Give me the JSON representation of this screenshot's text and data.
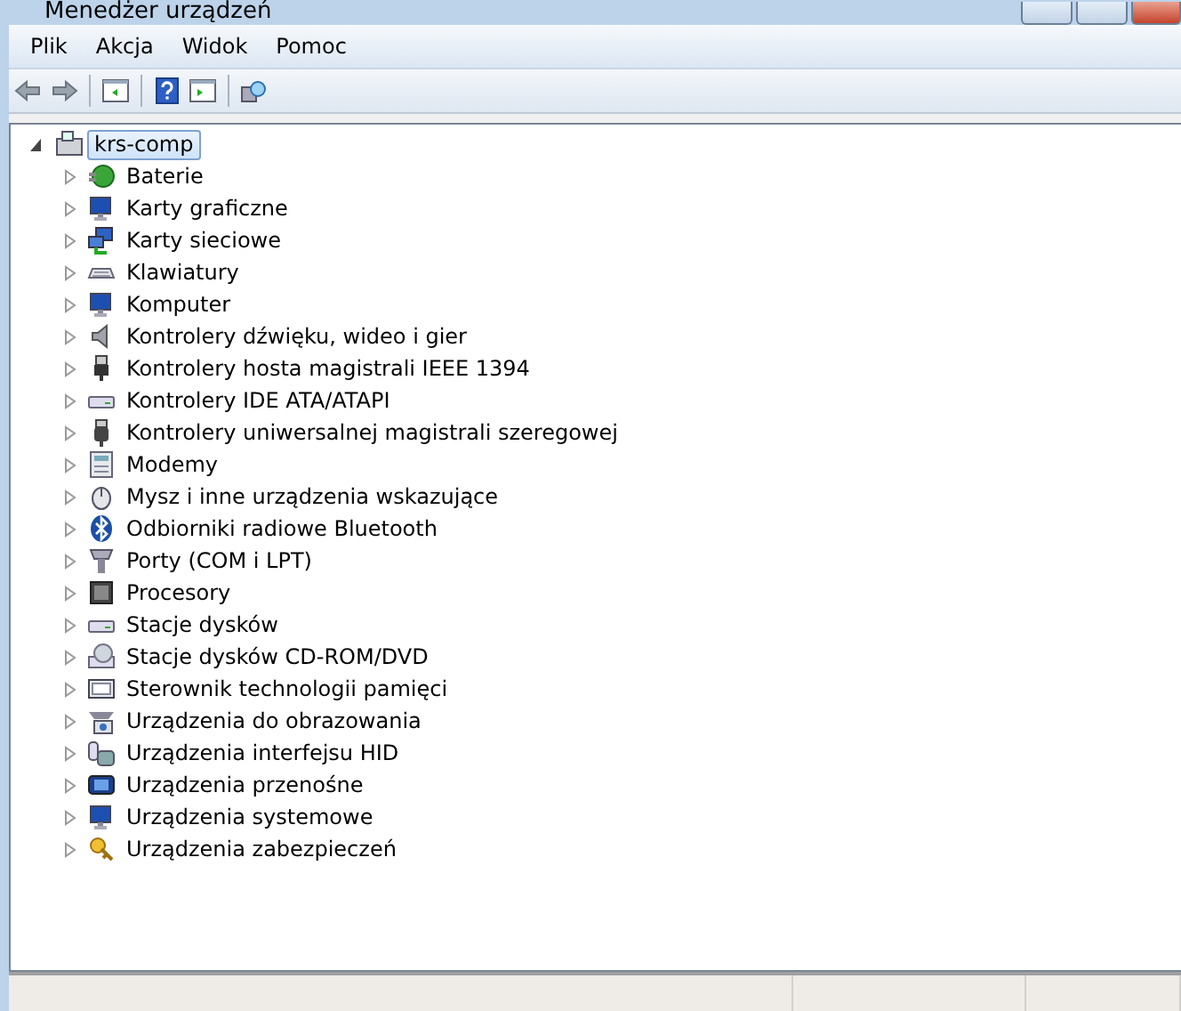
{
  "window": {
    "title": "Menedżer urządzeń"
  },
  "menu": [
    "Plik",
    "Akcja",
    "Widok",
    "Pomoc"
  ],
  "tree": {
    "label": "krs-comp",
    "expanded": true,
    "selected": true,
    "children": [
      {
        "label": "Baterie",
        "expanded": false,
        "selected": false
      },
      {
        "label": "Karty graficzne",
        "expanded": false,
        "selected": false
      },
      {
        "label": "Karty sieciowe",
        "expanded": false,
        "selected": false
      },
      {
        "label": "Klawiatury",
        "expanded": false,
        "selected": false
      },
      {
        "label": "Komputer",
        "expanded": false,
        "selected": false
      },
      {
        "label": "Kontrolery dźwięku, wideo i gier",
        "expanded": false,
        "selected": false
      },
      {
        "label": "Kontrolery hosta magistrali IEEE 1394",
        "expanded": false,
        "selected": false
      },
      {
        "label": "Kontrolery IDE ATA/ATAPI",
        "expanded": false,
        "selected": false
      },
      {
        "label": "Kontrolery uniwersalnej magistrali szeregowej",
        "expanded": false,
        "selected": false
      },
      {
        "label": "Modemy",
        "expanded": false,
        "selected": false
      },
      {
        "label": "Mysz i inne urządzenia wskazujące",
        "expanded": false,
        "selected": false
      },
      {
        "label": "Odbiorniki radiowe Bluetooth",
        "expanded": false,
        "selected": false
      },
      {
        "label": "Porty (COM i LPT)",
        "expanded": false,
        "selected": false
      },
      {
        "label": "Procesory",
        "expanded": false,
        "selected": false
      },
      {
        "label": "Stacje dysków",
        "expanded": false,
        "selected": false
      },
      {
        "label": "Stacje dysków CD-ROM/DVD",
        "expanded": false,
        "selected": false
      },
      {
        "label": "Sterownik technologii pamięci",
        "expanded": false,
        "selected": false
      },
      {
        "label": "Urządzenia do obrazowania",
        "expanded": false,
        "selected": false
      },
      {
        "label": "Urządzenia interfejsu HID",
        "expanded": false,
        "selected": false
      },
      {
        "label": "Urządzenia przenośne",
        "expanded": false,
        "selected": false
      },
      {
        "label": "Urządzenia systemowe",
        "expanded": false,
        "selected": false
      },
      {
        "label": "Urządzenia zabezpieczeń",
        "expanded": false,
        "selected": false
      }
    ]
  }
}
